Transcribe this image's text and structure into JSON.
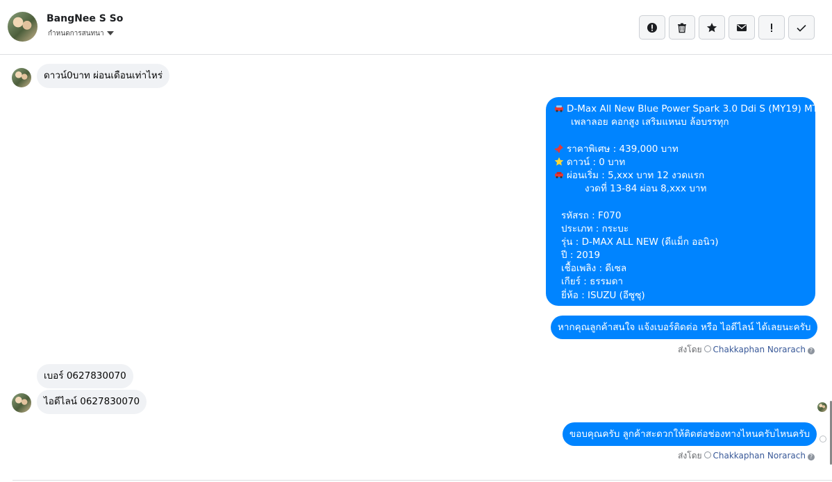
{
  "header": {
    "name": "BangNee S So",
    "subtitle": "กำหนดการสนทนา"
  },
  "toolbar": {
    "buttons": [
      {
        "icon": "alert-circle-icon"
      },
      {
        "icon": "trash-icon"
      },
      {
        "icon": "star-icon"
      },
      {
        "icon": "mail-icon"
      },
      {
        "icon": "exclamation-icon"
      },
      {
        "icon": "check-icon"
      }
    ]
  },
  "messages": {
    "m1": "ดาวน์0บาท ผ่อนเดือนเท่าไหร่",
    "offer": {
      "l1": "D-Max All New Blue Power Spark 3.0 Ddi S (MY19) MT",
      "l2": "เพลาลอย คอกสูง เสริมแหนบ ล้อบรรทุก",
      "l3": "ราคาพิเศษ : 439,000 บาท",
      "l4": "ดาวน์ : 0 บาท",
      "l5": "ผ่อนเริ่ม : 5,xxx บาท 12 งวดแรก",
      "l6": "งวดที่ 13-84 ผ่อน 8,xxx บาท",
      "l7": "รหัสรถ : F070",
      "l8": "ประเภท : กระบะ",
      "l9": "รุ่น : D-MAX ALL NEW (ดีแม็ก ออนิว)",
      "l10": "ปี : 2019",
      "l11": "เชื้อเพลิง : ดีเซล",
      "l12": "เกียร์ : ธรรมดา",
      "l13": "ยี่ห้อ : ISUZU (อีซูซุ)"
    },
    "m3": "หากคุณลูกค้าสนใจ แจ้งเบอร์ติดต่อ หรือ ไอดีไลน์ ได้เลยนะครับ",
    "sent_label": "ส่งโดย",
    "sender": "Chakkaphan Norarach",
    "m4": "เบอร์ 0627830070",
    "m5": "ไอดีไลน์ 0627830070",
    "m6": "ขอบคุณครับ ลูกค้าสะดวกให้ติดต่อช่องทางไหนครับไหนครับ"
  },
  "colors": {
    "outgoing": "#0084ff",
    "incoming": "#f0f2f5",
    "link": "#385898"
  }
}
